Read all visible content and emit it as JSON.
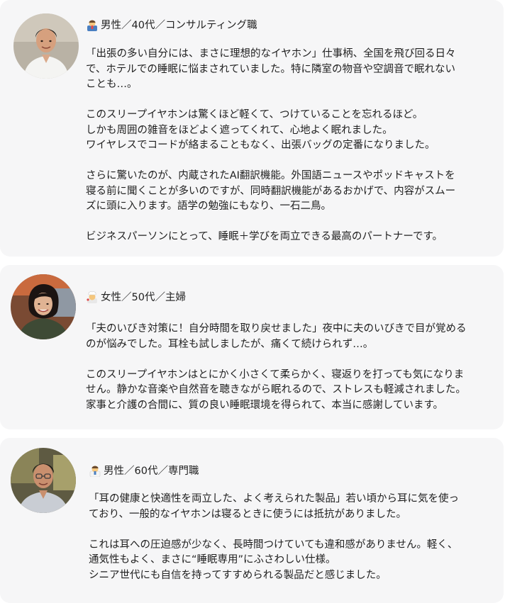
{
  "reviews": [
    {
      "header": "男性／40代／コンサルティング職",
      "avatar_icon": "man-photo-avatar",
      "emoji_icon": "man-office-worker-emoji",
      "paragraphs": [
        [
          "「出張の多い自分には、まさに理想的なイヤホン」仕事柄、全国を飛び回る日々",
          "で、ホテルでの睡眠に悩まされていました。特に隣室の物音や空調音で眠れない",
          "ことも…。"
        ],
        [
          "このスリープイヤホンは驚くほど軽くて、つけていることを忘れるほど。",
          "しかも周囲の雑音をほどよく遮ってくれて、心地よく眠れました。",
          "ワイヤレスでコードが絡まることもなく、出張バッグの定番になりました。"
        ],
        [
          "さらに驚いたのが、内蔵されたAI翻訳機能。外国語ニュースやポッドキャストを",
          "寝る前に聞くことが多いのですが、同時翻訳機能があるおかげで、内容がスムー",
          "ズに頭に入ります。語学の勉強にもなり、一石二鳥。"
        ],
        [
          "ビジネスパーソンにとって、睡眠＋学びを両立できる最高のパートナーです。"
        ]
      ]
    },
    {
      "header": "女性／50代／主婦",
      "avatar_icon": "woman-photo-avatar",
      "emoji_icon": "woman-cook-emoji",
      "paragraphs": [
        [
          "「夫のいびき対策に！自分時間を取り戻せました」夜中に夫のいびきで目が覚める",
          "のが悩みでした。耳栓も試しましたが、痛くて続けられず…。"
        ],
        [
          "このスリープイヤホンはとにかく小さくて柔らかく、寝返りを打っても気になりま",
          "せん。静かな音楽や自然音を聴きながら眠れるので、ストレスも軽減されました。",
          "家事と介護の合間に、質の良い睡眠環境を得られて、本当に感謝しています。"
        ]
      ]
    },
    {
      "header": "男性／60代／専門職",
      "avatar_icon": "older-man-photo-avatar",
      "emoji_icon": "man-professional-emoji",
      "paragraphs": [
        [
          "「耳の健康と快適性を両立した、よく考えられた製品」若い頃から耳に気を使っ",
          "ており、一般的なイヤホンは寝るときに使うには抵抗がありました。"
        ],
        [
          "これは耳への圧迫感が少なく、長時間つけていても違和感がありません。軽く、",
          "通気性もよく、まさに“睡眠専用”にふさわしい仕様。",
          "シニア世代にも自信を持ってすすめられる製品だと感じました。"
        ]
      ]
    }
  ]
}
